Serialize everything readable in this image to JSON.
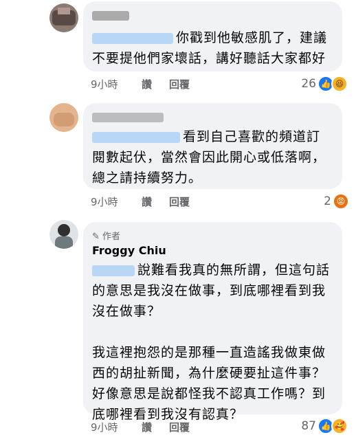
{
  "comments": [
    {
      "text_lines": [
        "你戳到他敏感肌了，建議",
        "不要提他們家壞話，講好聽話大家都好"
      ],
      "time": "9小時",
      "like_label": "讚",
      "reply_label": "回覆",
      "reaction_count": "26",
      "reactions": [
        "like-icon",
        "haha-icon"
      ]
    },
    {
      "text_lines": [
        "看到自己喜歡的頻道訂",
        "閱數起伏，當然會因此開心或低落啊，",
        "總之請持續努力。"
      ],
      "time": "9小時",
      "like_label": "讚",
      "reply_label": "回覆",
      "reaction_count": "2",
      "reactions": [
        "angry-icon"
      ]
    },
    {
      "author_badge": "作者",
      "author_name": "Froggy Chiu",
      "text_lines": [
        "說難看我真的無所謂，但這句話",
        "的意思是我沒在做事，到底哪裡看到我",
        "沒在做事？",
        "",
        "我這裡抱怨的是那種一直造謠我做東做",
        "西的胡扯新聞，為什麼硬要扯這件事？",
        "好像意思是說都怪我不認真工作嗎？到",
        "底哪裡看到我沒有認真？"
      ],
      "time": "9小時",
      "like_label": "讚",
      "reply_label": "回覆",
      "reaction_count": "87",
      "reactions": [
        "like-icon",
        "care-icon"
      ]
    }
  ],
  "colors": {
    "bubble": "#f0f2f5",
    "meta": "#65676b",
    "like": "#1877f2"
  }
}
